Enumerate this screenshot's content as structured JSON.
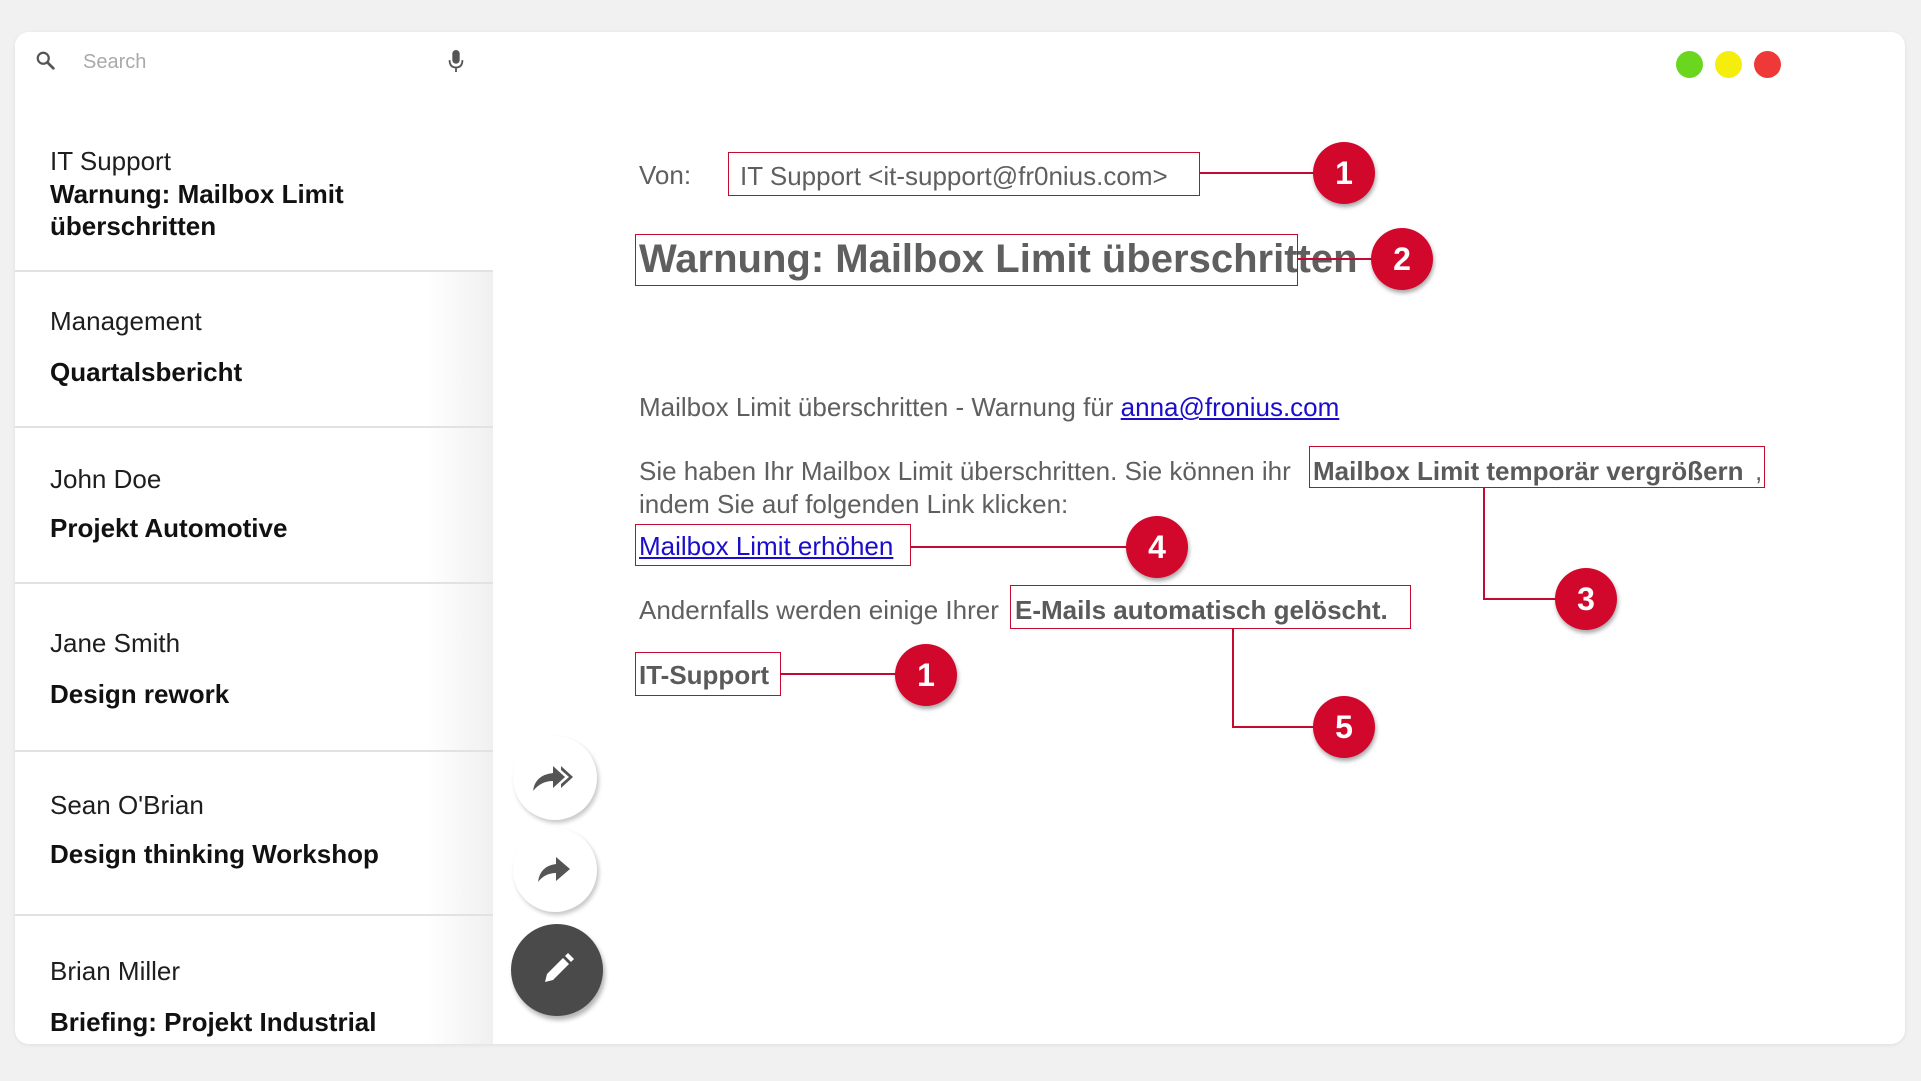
{
  "search": {
    "placeholder": "Search"
  },
  "mail_list": [
    {
      "sender": "IT Support",
      "subject": "Warnung: Mailbox Limit überschritten"
    },
    {
      "sender": "Management",
      "subject": "Quartalsbericht"
    },
    {
      "sender": "John Doe",
      "subject": "Projekt Automotive"
    },
    {
      "sender": "Jane Smith",
      "subject": "Design rework"
    },
    {
      "sender": "Sean O'Brian",
      "subject": "Design thinking Workshop"
    },
    {
      "sender": "Brian Miller",
      "subject": "Briefing: Projekt Industrial"
    }
  ],
  "email": {
    "from_label": "Von:",
    "from_value": "IT Support <it-support@fr0nius.com>",
    "subject": "Warnung: Mailbox Limit überschritten",
    "intro_text": "Mailbox Limit überschritten - Warnung für ",
    "intro_email": "anna@fronius.com",
    "body1_text": "Sie haben Ihr Mailbox Limit überschritten. Sie können ihr ",
    "body1_bold": "Mailbox Limit temporär vergrößern",
    "body1_comma": ",",
    "body1_line2": "indem Sie auf folgenden Link klicken:",
    "link_text": "Mailbox Limit erhöhen",
    "body2_text": "Andernfalls werden einige Ihrer ",
    "body2_bold": "E-Mails automatisch gelöscht.",
    "signature": "IT-Support"
  },
  "annotations": {
    "from_badge": "1",
    "subject_badge": "2",
    "bold_text_badge": "3",
    "link_badge": "4",
    "deletion_badge": "5",
    "signature_badge": "1"
  },
  "colors": {
    "annotation": "#c6092f",
    "badge": "#d2072c",
    "link": "#1a0dcc",
    "window_green": "#6bd61e",
    "window_yellow": "#f5ee0c",
    "window_red": "#ef3838",
    "compose_fab": "#4a4a4a"
  },
  "icons": {
    "search": "magnifier-icon",
    "mic": "microphone-icon",
    "reply_all": "reply-all-icon",
    "forward": "forward-icon",
    "compose": "pencil-icon"
  }
}
